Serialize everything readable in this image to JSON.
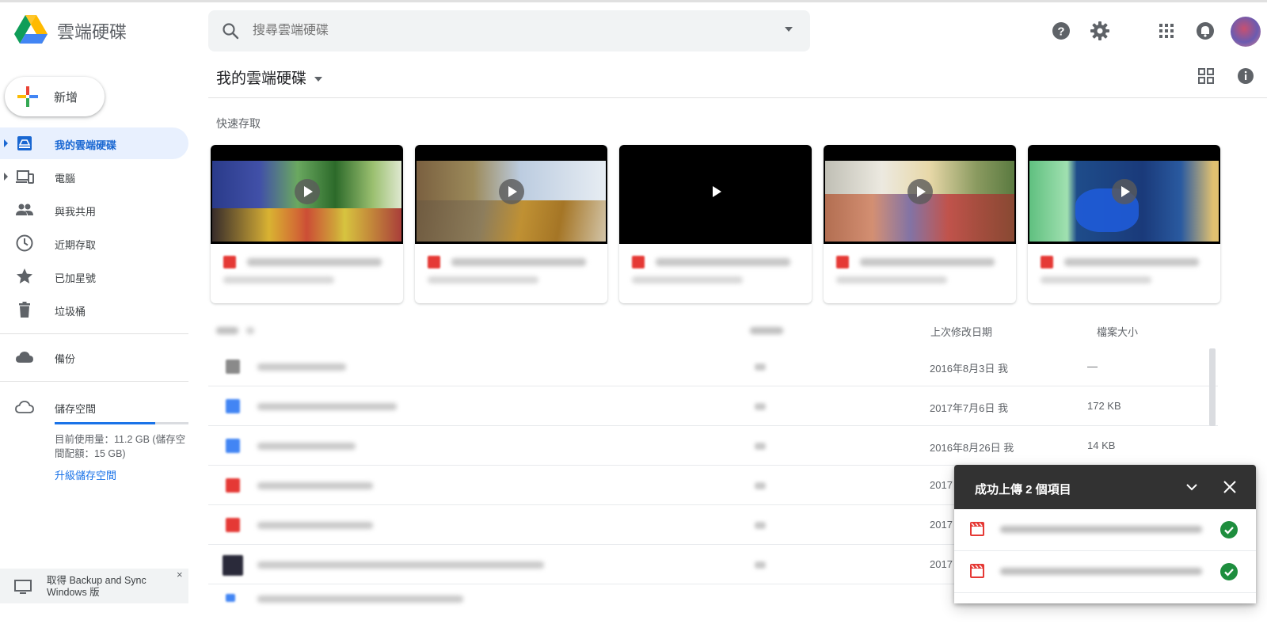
{
  "app": {
    "name": "雲端硬碟"
  },
  "search": {
    "placeholder": "搜尋雲端硬碟"
  },
  "sidebar": {
    "new_label": "新增",
    "items": [
      {
        "label": "我的雲端硬碟",
        "icon": "drive-icon",
        "active": true
      },
      {
        "label": "電腦",
        "icon": "computer-icon"
      },
      {
        "label": "與我共用",
        "icon": "people-icon"
      },
      {
        "label": "近期存取",
        "icon": "clock-icon"
      },
      {
        "label": "已加星號",
        "icon": "star-icon"
      },
      {
        "label": "垃圾桶",
        "icon": "trash-icon"
      }
    ],
    "backup_label": "備份",
    "storage_label": "儲存空間",
    "storage_usage": "目前使用量：11.2 GB (儲存空間配額：15 GB)",
    "storage_fraction": 0.75,
    "upgrade_label": "升級儲存空間",
    "backup_promo": {
      "line1": "取得 Backup and Sync",
      "line2": "Windows 版",
      "close": "×"
    }
  },
  "main": {
    "title": "我的雲端硬碟",
    "quick_access_label": "快速存取",
    "columns": {
      "modified": "上次修改日期",
      "size": "檔案大小"
    },
    "rows": [
      {
        "type": "folder",
        "modified": "2016年8月3日 我",
        "size": "—"
      },
      {
        "type": "doc",
        "modified": "2017年7月6日 我",
        "size": "172 KB"
      },
      {
        "type": "doc",
        "modified": "2016年8月26日 我",
        "size": "14 KB"
      },
      {
        "type": "pdf",
        "modified": "2017",
        "size": ""
      },
      {
        "type": "pdf",
        "modified": "2017",
        "size": ""
      },
      {
        "type": "video",
        "modified": "2017",
        "size": ""
      }
    ]
  },
  "upload_panel": {
    "title": "成功上傳 2 個項目",
    "items": [
      {
        "status": "done"
      },
      {
        "status": "done"
      }
    ]
  },
  "colors": {
    "accent": "#1a73e8",
    "active_bg": "#e8f0fe",
    "success": "#1e8e3e",
    "panel_header": "#323232"
  }
}
